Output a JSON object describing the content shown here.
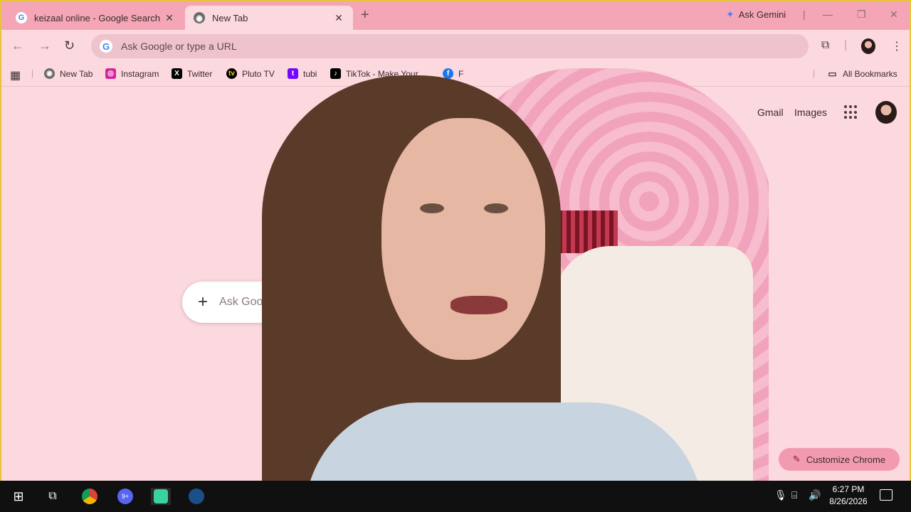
{
  "browser": {
    "tabs": [
      {
        "title": "keizaal online - Google Search",
        "favicon": "google-g-icon",
        "active": false
      },
      {
        "title": "New Tab",
        "favicon": "chrome-icon",
        "active": true
      }
    ],
    "ask_gemini": "Ask Gemini",
    "omnibox_placeholder": "Ask Google or type a URL",
    "bookmarks": [
      {
        "label": "New Tab",
        "icon": "chrome-icon"
      },
      {
        "label": "Instagram",
        "icon": "instagram-icon"
      },
      {
        "label": "Twitter",
        "icon": "x-icon"
      },
      {
        "label": "Pluto TV",
        "icon": "pluto-tv-icon"
      },
      {
        "label": "tubi",
        "icon": "tubi-icon"
      },
      {
        "label": "TikTok - Make Your...",
        "icon": "tiktok-icon"
      },
      {
        "label": "F",
        "icon": "facebook-icon"
      }
    ],
    "all_bookmarks": "All Bookmarks"
  },
  "ntp": {
    "gmail": "Gmail",
    "images": "Images",
    "search_placeholder": "Ask Goo",
    "customize": "Customize Chrome"
  },
  "taskbar": {
    "time": "6:27 PM",
    "date": "8/26/2026",
    "discord_badge": "9+"
  },
  "colors": {
    "tabstrip": "#f4a6b6",
    "page_bg": "#fbd9df",
    "accent": "#f29bb0"
  }
}
